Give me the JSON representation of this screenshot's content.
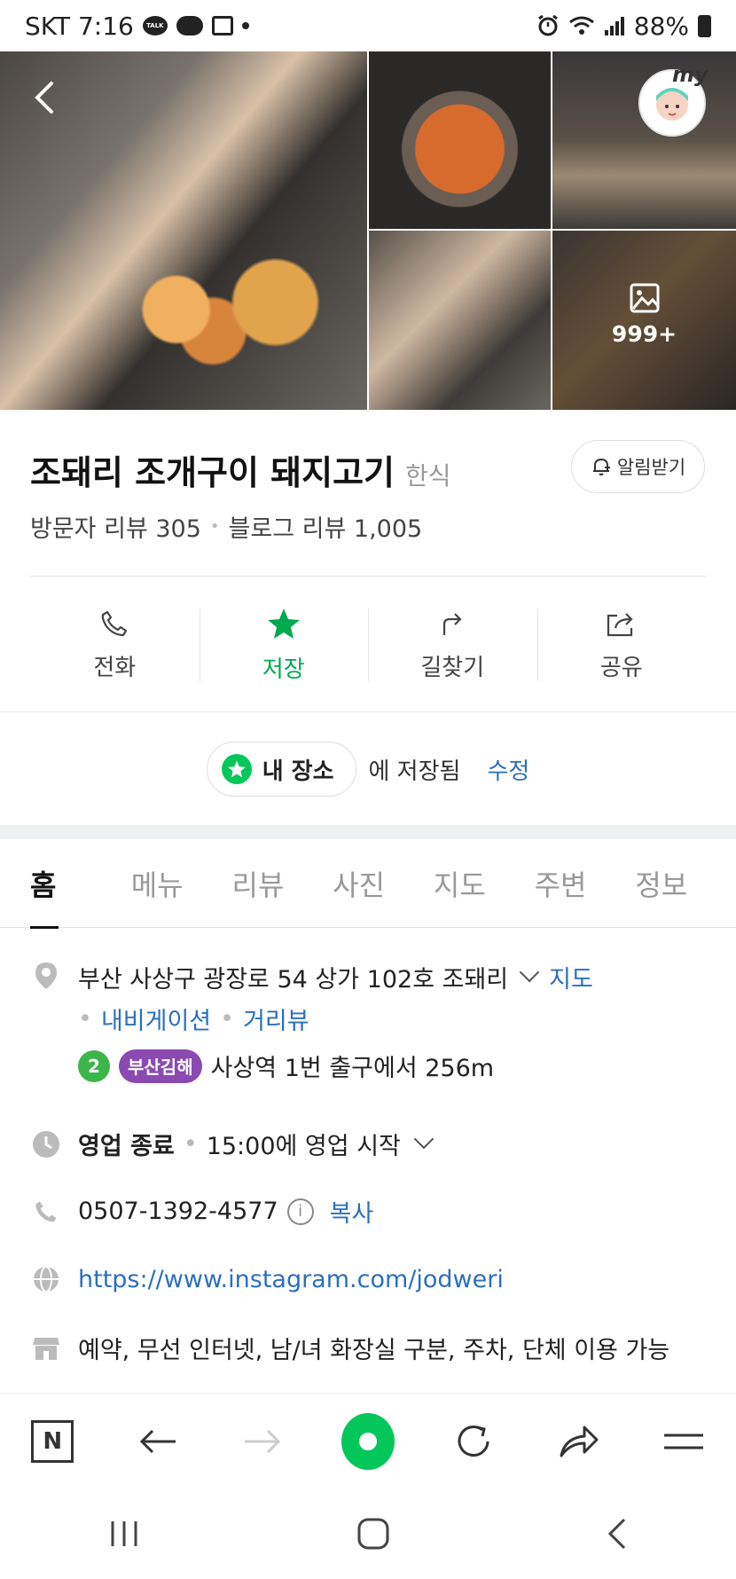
{
  "status_bar": {
    "time": "SKT 7:16",
    "talk_label": "TALK",
    "battery": "88%"
  },
  "gallery": {
    "more_count": "999+",
    "my_tag": "my"
  },
  "place": {
    "name": "조돼리 조개구이 돼지고기",
    "category": "한식",
    "alarm_label": "알림받기",
    "visitor_review": "방문자 리뷰 305",
    "blog_review": "블로그 리뷰 1,005"
  },
  "actions": [
    {
      "label": "전화",
      "icon": "phone-icon"
    },
    {
      "label": "저장",
      "icon": "star-icon"
    },
    {
      "label": "길찾기",
      "icon": "directions-icon"
    },
    {
      "label": "공유",
      "icon": "share-icon"
    }
  ],
  "saved": {
    "chip_label": "내 장소",
    "saved_text": "에 저장됨",
    "edit_label": "수정"
  },
  "tabs": [
    "홈",
    "메뉴",
    "리뷰",
    "사진",
    "지도",
    "주변",
    "정보"
  ],
  "details": {
    "address": "부산 사상구 광장로 54 상가 102호 조돼리",
    "map_link": "지도",
    "navigation_link": "내비게이션",
    "streetview_link": "거리뷰",
    "subway_line_number": "2",
    "subway_line_name": "부산김해",
    "subway_text": "사상역 1번 출구에서 256m",
    "hours_status": "영업 종료",
    "hours_text": "15:00에 영업 시작",
    "phone": "0507-1392-4577",
    "copy_label": "복사",
    "website": "https://www.instagram.com/jodweri",
    "amenities": "예약, 무선 인터넷, 남/녀 화장실 구분, 주차, 단체 이용 가능"
  },
  "colors": {
    "brand_green": "#03c75a",
    "link_blue": "#2b6fbd",
    "subway_line2": "#3cb54a",
    "subway_busan_gimhae": "#8a4ab2"
  }
}
